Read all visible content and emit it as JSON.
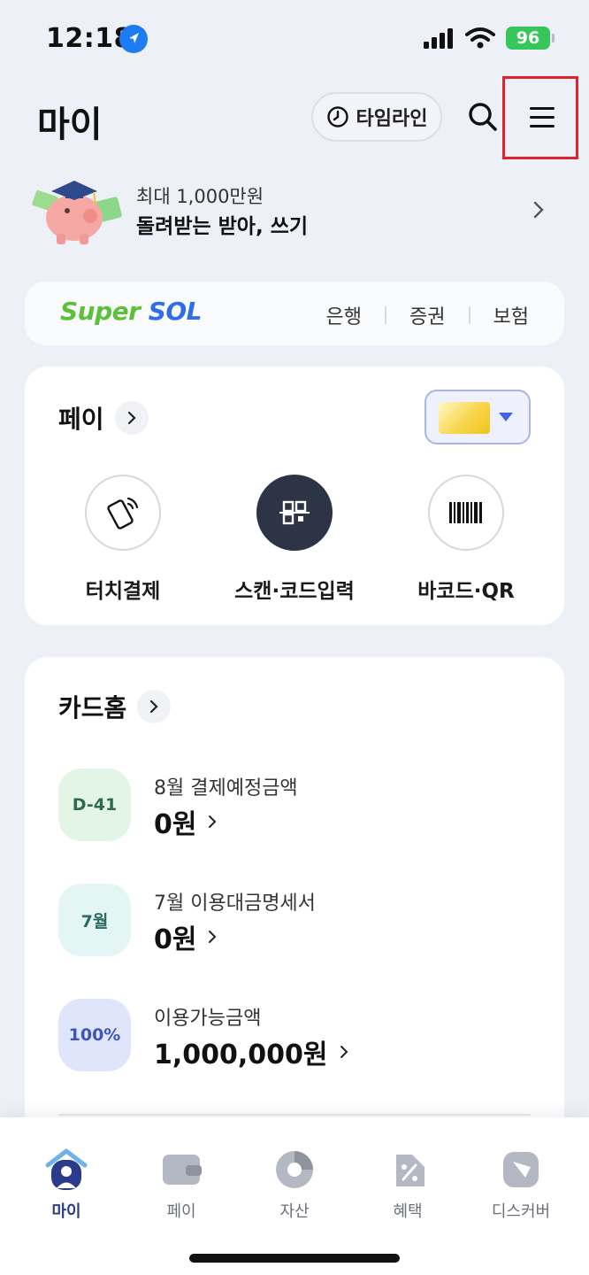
{
  "status_bar": {
    "time": "12:18",
    "battery": "96"
  },
  "header": {
    "title": "마이",
    "timeline_label": "타임라인"
  },
  "promo": {
    "subtitle": "최대 1,000만원",
    "title": "돌려받는 받아, 쓰기"
  },
  "supersol": {
    "logo_left": "Super",
    "logo_right": "SOL",
    "links": [
      "은행",
      "증권",
      "보험"
    ]
  },
  "pay": {
    "title": "페이",
    "items": [
      {
        "label": "터치결제",
        "icon": "touch-pay-icon"
      },
      {
        "label": "스캔·코드입력",
        "icon": "scan-icon"
      },
      {
        "label": "바코드·QR",
        "icon": "barcode-icon"
      }
    ]
  },
  "card_home": {
    "title": "카드홈",
    "rows": [
      {
        "badge": "D-41",
        "label": "8월 결제예정금액",
        "value": "0원"
      },
      {
        "badge": "7월",
        "label": "7월 이용대금명세서",
        "value": "0원"
      },
      {
        "badge": "100%",
        "label": "이용가능금액",
        "value": "1,000,000원"
      }
    ]
  },
  "bottom_nav": {
    "items": [
      {
        "label": "마이",
        "active": true
      },
      {
        "label": "페이",
        "active": false
      },
      {
        "label": "자산",
        "active": false
      },
      {
        "label": "혜택",
        "active": false
      },
      {
        "label": "디스커버",
        "active": false
      }
    ]
  },
  "colors": {
    "background": "#eef0f7",
    "accent_blue": "#3f63e4",
    "brand_green": "#5cc03a",
    "highlight_red": "#e0242b",
    "nav_active": "#2b3b8c"
  }
}
